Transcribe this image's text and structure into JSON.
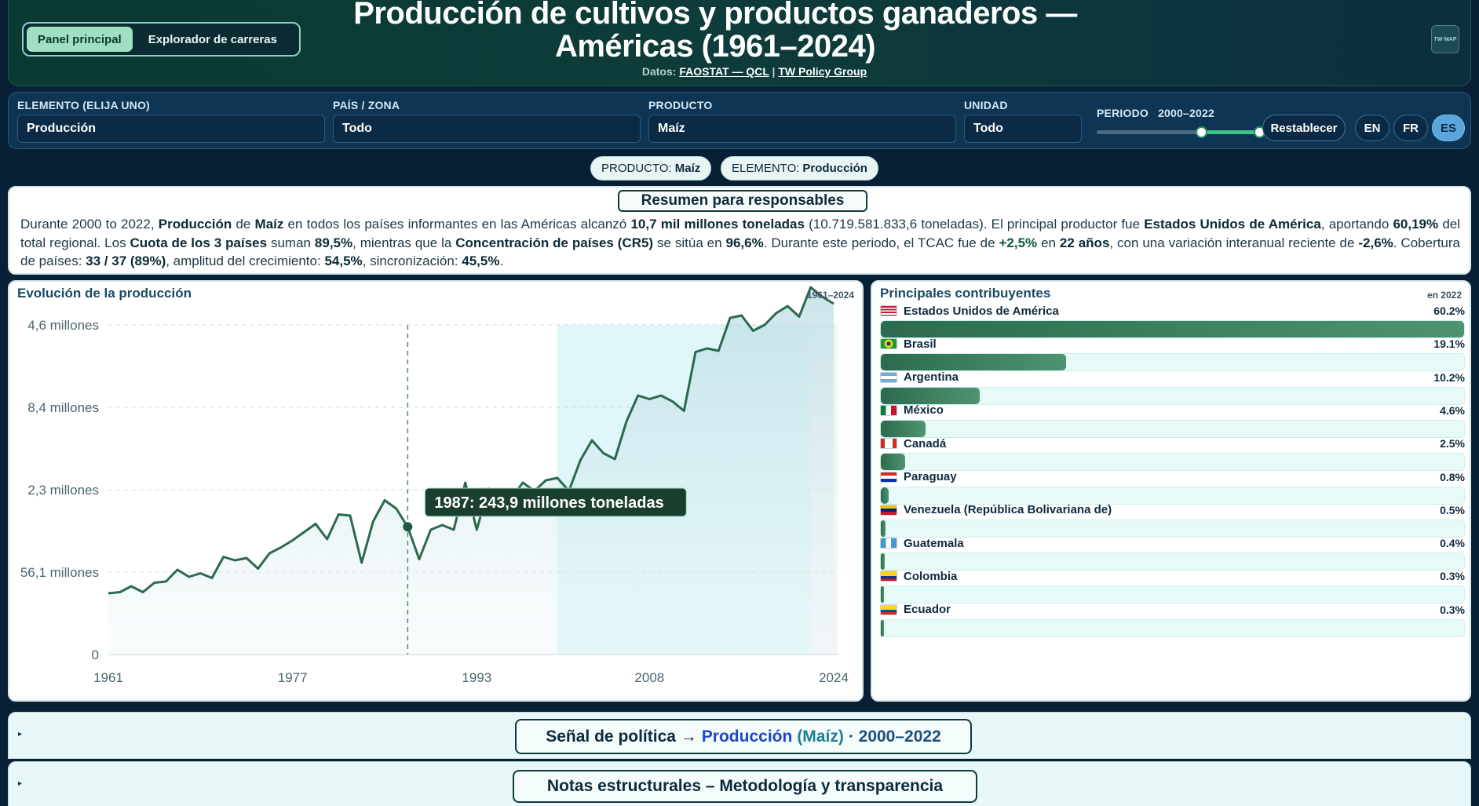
{
  "header": {
    "tabs": [
      {
        "label": "Panel principal",
        "active": true
      },
      {
        "label": "Explorador de carreras",
        "active": false
      }
    ],
    "title": "Producción de cultivos y productos ganaderos — Américas (1961–2024)",
    "data_prefix": "Datos:",
    "source_link": "FAOSTAT — QCL",
    "separator": "|",
    "org_link": "TW Policy Group",
    "logo_text": "TW·MAP"
  },
  "filters": {
    "element_label": "ELEMENTO (ELIJA UNO)",
    "element_value": "Producción",
    "country_label": "PAÍS / ZONA",
    "country_value": "Todo",
    "product_label": "PRODUCTO",
    "product_value": "Maíz",
    "unit_label": "UNIDAD",
    "unit_value": "Todo",
    "period_label": "PERIODO",
    "period_value": "2000–2022",
    "period_start_fraction": 0.6349,
    "period_end_fraction": 0.9841,
    "reset_label": "Restablecer",
    "languages": [
      "EN",
      "FR",
      "ES"
    ],
    "active_language": "ES"
  },
  "chips": {
    "product_key": "PRODUCTO:",
    "product_val": "Maíz",
    "element_key": "ELEMENTO:",
    "element_val": "Producción"
  },
  "summary": {
    "title": "Resumen para responsables",
    "t1": "Durante 2000 to 2022, ",
    "b1": "Producción",
    "t2": " de ",
    "b2": "Maíz",
    "t3": " en todos los países informantes en las Américas alcanzó ",
    "b3": "10,7 mil millones toneladas",
    "t4": " (10.719.581.833,6 toneladas). El principal productor fue ",
    "b4": "Estados Unidos de América",
    "t5": ", aportando ",
    "b5": "60,19%",
    "t6": " del total regional. Los ",
    "b6": "Cuota de los 3 países",
    "t7": " suman ",
    "b7": "89,5%",
    "t8": ", mientras que la ",
    "b8": "Concentración de países (CR5)",
    "t9": " se sitúa en ",
    "b9": "96,6%",
    "t10": ". Durante este periodo, el TCAC fue de ",
    "b10": "+2,5%",
    "t11": " en ",
    "b11": "22 años",
    "t12": ", con una variación interanual reciente de ",
    "b12": "-2,6%",
    "t13": ". Cobertura de países: ",
    "b13": "33 / 37 (89%)",
    "t14": ", amplitud del crecimiento: ",
    "b14": "54,5%",
    "t15": ", sincronización: ",
    "b15": "45,5%",
    "t16": "."
  },
  "chart": {
    "title": "Evolución de la producción",
    "range_label": "1961–2024",
    "tooltip": "1987: 243,9 millones toneladas"
  },
  "chart_data": {
    "type": "area",
    "title": "Evolución de la producción",
    "x_ticks": [
      "1961",
      "1977",
      "1993",
      "2008",
      "2024"
    ],
    "y_ticks": [
      "0",
      "56,1 millones",
      "2,3 millones",
      "8,4 millones",
      "4,6 millones"
    ],
    "y_tick_values": [
      0,
      70,
      140,
      210,
      280
    ],
    "xlim": [
      1961,
      2024
    ],
    "ylim": [
      0,
      280
    ],
    "highlight_period": [
      2000,
      2022
    ],
    "marker": {
      "x": 1987,
      "y": 108.5,
      "label": "1987: 243,9 millones toneladas"
    },
    "series": [
      {
        "x": [
          1961,
          1962,
          1963,
          1964,
          1965,
          1966,
          1967,
          1968,
          1969,
          1970,
          1971,
          1972,
          1973,
          1974,
          1975,
          1976,
          1977,
          1978,
          1979,
          1980,
          1981,
          1982,
          1983,
          1984,
          1985,
          1986,
          1987,
          1988,
          1989,
          1990,
          1991,
          1992,
          1993,
          1994,
          1995,
          1996,
          1997,
          1998,
          1999,
          2000,
          2001,
          2002,
          2003,
          2004,
          2005,
          2006,
          2007,
          2008,
          2009,
          2010,
          2011,
          2012,
          2013,
          2014,
          2015,
          2016,
          2017,
          2018,
          2019,
          2020,
          2021,
          2022,
          2023,
          2024
        ],
        "values": [
          52,
          53,
          58,
          53,
          61,
          62,
          72,
          66,
          69,
          65,
          83,
          80,
          82,
          73,
          86,
          91,
          97,
          104,
          111,
          98,
          119,
          118,
          78,
          113,
          131,
          124,
          108.5,
          81,
          106,
          110,
          106,
          146,
          106,
          141,
          124,
          133,
          146,
          139,
          148,
          150,
          139,
          165,
          182,
          171,
          166,
          198,
          220,
          217,
          220,
          215,
          207,
          257,
          260,
          258,
          286,
          288,
          275,
          280,
          290,
          296,
          287,
          312,
          304,
          298
        ]
      }
    ],
    "grid": true
  },
  "contributors": {
    "title": "Principales contribuyentes",
    "year_label": "en 2022",
    "items": [
      {
        "name": "Estados Unidos de América",
        "pct": "60.2%",
        "value": 60.2,
        "flag": "us"
      },
      {
        "name": "Brasil",
        "pct": "19.1%",
        "value": 19.1,
        "flag": "br"
      },
      {
        "name": "Argentina",
        "pct": "10.2%",
        "value": 10.2,
        "flag": "ar"
      },
      {
        "name": "México",
        "pct": "4.6%",
        "value": 4.6,
        "flag": "mx"
      },
      {
        "name": "Canadá",
        "pct": "2.5%",
        "value": 2.5,
        "flag": "ca"
      },
      {
        "name": "Paraguay",
        "pct": "0.8%",
        "value": 0.8,
        "flag": "py"
      },
      {
        "name": "Venezuela (República Bolivariana de)",
        "pct": "0.5%",
        "value": 0.5,
        "flag": "ve"
      },
      {
        "name": "Guatemala",
        "pct": "0.4%",
        "value": 0.4,
        "flag": "gt"
      },
      {
        "name": "Colombia",
        "pct": "0.3%",
        "value": 0.3,
        "flag": "co"
      },
      {
        "name": "Ecuador",
        "pct": "0.3%",
        "value": 0.3,
        "flag": "ec"
      }
    ]
  },
  "accordions": {
    "policy_prefix": "Señal de política →",
    "policy_element": "Producción",
    "policy_product": "(Maíz)",
    "policy_period": "· 2000–2022",
    "notes_title": "Notas estructurales – Metodología y transparencia",
    "arrow": "▸"
  },
  "colors": {
    "page_bg": "#082036",
    "line": "#2a6a4e",
    "highlight_band": "#dff7f9",
    "accent_green": "#9fe0c4",
    "accent_blue": "#5aa5dc"
  }
}
